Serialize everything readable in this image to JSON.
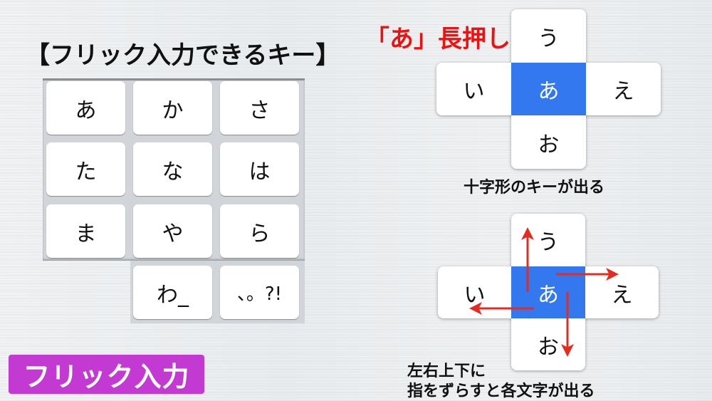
{
  "title": "【フリック入力できるキー】",
  "keyboard": {
    "keys": [
      "あ",
      "か",
      "さ",
      "た",
      "な",
      "は",
      "ま",
      "や",
      "ら",
      "わ_",
      "、。?!"
    ]
  },
  "badge": "フリック入力",
  "long_press_label": "「あ」長押し",
  "cross_top": {
    "up": "う",
    "left": "い",
    "center": "あ",
    "right": "え",
    "down": "お",
    "caption": "十字形のキーが出る"
  },
  "cross_bottom": {
    "up": "う",
    "left": "い",
    "center": "あ",
    "right": "え",
    "down": "お",
    "caption_line1": "左右上下に",
    "caption_line2": "指をずらすと各文字が出る"
  },
  "colors": {
    "highlight": "#3478f0",
    "arrow": "#e52a20",
    "badge": "#c23ad2",
    "red_text": "#ee1111"
  }
}
